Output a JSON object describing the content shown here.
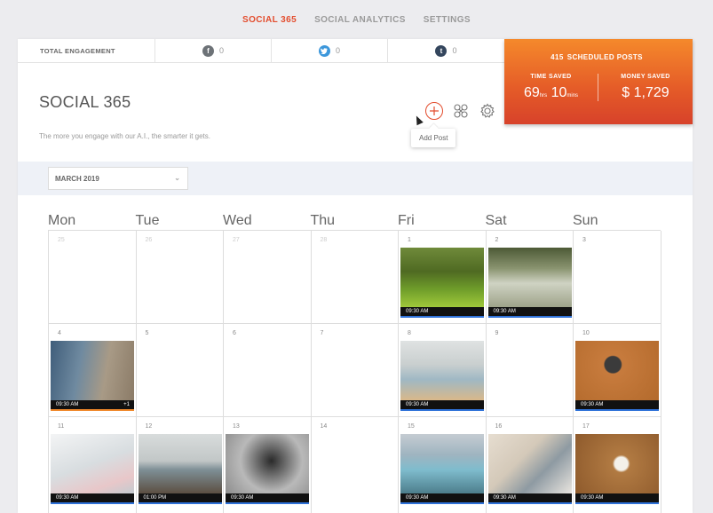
{
  "nav": {
    "items": [
      "SOCIAL 365",
      "SOCIAL ANALYTICS",
      "SETTINGS"
    ]
  },
  "engagement": {
    "label": "TOTAL ENGAGEMENT",
    "counts": [
      {
        "icon": "facebook-icon",
        "value": "0",
        "color": "#6d7277"
      },
      {
        "icon": "twitter-icon",
        "value": "0",
        "color": "#3c97db"
      },
      {
        "icon": "tumblr-icon",
        "value": "0",
        "color": "#34465d"
      }
    ]
  },
  "stats": {
    "scheduled_count": "415",
    "scheduled_label": "SCHEDULED POSTS",
    "time_saved_label": "TIME SAVED",
    "time_hours": "69",
    "hrs_unit": "hrs",
    "time_mins": "10",
    "mins_unit": "mins",
    "money_saved_label": "MONEY SAVED",
    "money_value": "$ 1,729"
  },
  "page": {
    "title": "SOCIAL 365",
    "subtitle": "The more you engage with our A.I., the smarter it gets.",
    "tooltip": "Add Post",
    "month": "MARCH 2019"
  },
  "calendar": {
    "day_headers": [
      "Mon",
      "Tue",
      "Wed",
      "Thu",
      "Fri",
      "Sat",
      "Sun"
    ],
    "weeks": [
      [
        {
          "num": "25",
          "faded": true
        },
        {
          "num": "26",
          "faded": true
        },
        {
          "num": "27",
          "faded": true
        },
        {
          "num": "28",
          "faded": true
        },
        {
          "num": "1",
          "post": {
            "time": "09:30 AM",
            "scene": "forest"
          }
        },
        {
          "num": "2",
          "post": {
            "time": "09:30 AM",
            "scene": "grass"
          }
        },
        {
          "num": "3"
        }
      ],
      [
        {
          "num": "4",
          "post": {
            "time": "09:30 AM",
            "extra": "+1",
            "scene": "man-sitting",
            "orange": true
          }
        },
        {
          "num": "5"
        },
        {
          "num": "6"
        },
        {
          "num": "7"
        },
        {
          "num": "8",
          "post": {
            "time": "09:30 AM",
            "scene": "easel"
          }
        },
        {
          "num": "9"
        },
        {
          "num": "10",
          "post": {
            "time": "09:30 AM",
            "scene": "dog"
          }
        }
      ],
      [
        {
          "num": "11",
          "post": {
            "time": "09:30 AM",
            "scene": "papers"
          }
        },
        {
          "num": "12",
          "post": {
            "time": "01:00 PM",
            "scene": "coast"
          }
        },
        {
          "num": "13",
          "post": {
            "time": "09:30 AM",
            "scene": "banknote"
          }
        },
        {
          "num": "14"
        },
        {
          "num": "15",
          "post": {
            "time": "09:30 AM",
            "scene": "lagoon"
          }
        },
        {
          "num": "16",
          "post": {
            "time": "09:30 AM",
            "scene": "desk"
          }
        },
        {
          "num": "17",
          "post": {
            "time": "09:30 AM",
            "scene": "coffee"
          }
        }
      ]
    ]
  }
}
